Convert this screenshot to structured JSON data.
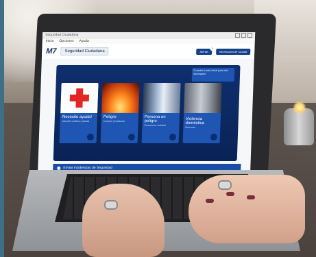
{
  "window": {
    "title": "Seguridad Ciudadana",
    "menu": [
      "Inicio",
      "Opciones",
      "Ayuda"
    ]
  },
  "app": {
    "logo": "M7",
    "name": "Seguridad Ciudadana",
    "header_buttons": [
      {
        "label": "Alertas",
        "badge": "1"
      },
      {
        "label": "Información de Ciudad"
      }
    ],
    "info_box": "Consulte la web oficial para más información"
  },
  "cards": [
    {
      "title": "Necesito ayuda!",
      "subtitle": "Atención médica / policial",
      "image": "red-cross"
    },
    {
      "title": "Peligro",
      "subtitle": "Incendio | Accidente",
      "image": "fire"
    },
    {
      "title": "Persona en peligro",
      "subtitle": "Persona en soledad",
      "image": "hallway"
    },
    {
      "title": "Violencia doméstica",
      "subtitle": "Denuncia",
      "image": "person"
    }
  ],
  "footer": {
    "label": "Enviar incidencias de Seguridad"
  },
  "colors": {
    "panel": "#0e2f6e",
    "card": "#1f56b3",
    "accent_red": "#e42525"
  }
}
